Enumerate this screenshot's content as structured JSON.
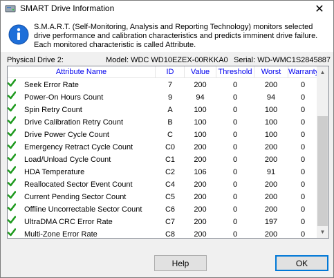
{
  "window": {
    "title": "SMART Drive Information",
    "close_glyph": "✕"
  },
  "info": {
    "text": "S.M.A.R.T. (Self-Monitoring, Analysis and Reporting Technology) monitors selected drive performance and calibration characteristics and predicts imminent drive failure. Each monitored characteristic is called Attribute.",
    "icon": "info-icon"
  },
  "drive": {
    "label": "Physical Drive 2:",
    "model": "Model: WDC WD10EZEX-00RKKA0",
    "serial": "Serial: WD-WMC1S2845887"
  },
  "table": {
    "headers": {
      "name": "Attribute Name",
      "id": "ID",
      "value": "Value",
      "threshold": "Threshold",
      "worst": "Worst",
      "warranty": "Warranty"
    },
    "rows": [
      {
        "name": "Seek Error Rate",
        "id": "7",
        "value": "200",
        "threshold": "0",
        "worst": "200",
        "warranty": "0"
      },
      {
        "name": "Power-On Hours Count",
        "id": "9",
        "value": "94",
        "threshold": "0",
        "worst": "94",
        "warranty": "0"
      },
      {
        "name": "Spin Retry Count",
        "id": "A",
        "value": "100",
        "threshold": "0",
        "worst": "100",
        "warranty": "0"
      },
      {
        "name": "Drive Calibration Retry Count",
        "id": "B",
        "value": "100",
        "threshold": "0",
        "worst": "100",
        "warranty": "0"
      },
      {
        "name": "Drive Power Cycle Count",
        "id": "C",
        "value": "100",
        "threshold": "0",
        "worst": "100",
        "warranty": "0"
      },
      {
        "name": "Emergency Retract Cycle Count",
        "id": "C0",
        "value": "200",
        "threshold": "0",
        "worst": "200",
        "warranty": "0"
      },
      {
        "name": "Load/Unload Cycle Count",
        "id": "C1",
        "value": "200",
        "threshold": "0",
        "worst": "200",
        "warranty": "0"
      },
      {
        "name": "HDA Temperature",
        "id": "C2",
        "value": "106",
        "threshold": "0",
        "worst": "91",
        "warranty": "0"
      },
      {
        "name": "Reallocated Sector Event Count",
        "id": "C4",
        "value": "200",
        "threshold": "0",
        "worst": "200",
        "warranty": "0"
      },
      {
        "name": "Current Pending Sector Count",
        "id": "C5",
        "value": "200",
        "threshold": "0",
        "worst": "200",
        "warranty": "0"
      },
      {
        "name": "Offline Uncorrectable Sector Count",
        "id": "C6",
        "value": "200",
        "threshold": "0",
        "worst": "200",
        "warranty": "0"
      },
      {
        "name": "UltraDMA CRC Error Rate",
        "id": "C7",
        "value": "200",
        "threshold": "0",
        "worst": "197",
        "warranty": "0"
      },
      {
        "name": "Multi-Zone Error Rate",
        "id": "C8",
        "value": "200",
        "threshold": "0",
        "worst": "200",
        "warranty": "0"
      }
    ]
  },
  "buttons": {
    "help": "Help",
    "ok": "OK"
  },
  "colors": {
    "header_text": "#0000ee",
    "check_green": "#1f9a1f",
    "accent": "#0078d7"
  }
}
